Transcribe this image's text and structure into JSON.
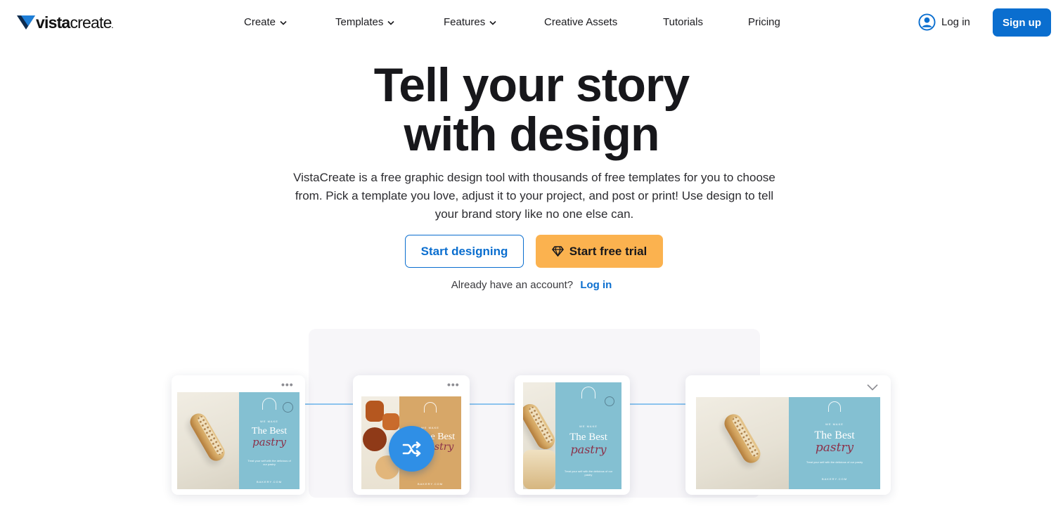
{
  "brand": {
    "logo_bold": "vista",
    "logo_light": "create",
    "logo_mark": "."
  },
  "nav": {
    "items": [
      {
        "label": "Create",
        "has_dropdown": true
      },
      {
        "label": "Templates",
        "has_dropdown": true
      },
      {
        "label": "Features",
        "has_dropdown": true
      },
      {
        "label": "Creative Assets",
        "has_dropdown": false
      },
      {
        "label": "Tutorials",
        "has_dropdown": false
      },
      {
        "label": "Pricing",
        "has_dropdown": false
      }
    ],
    "login_label": "Log in",
    "signup_label": "Sign up"
  },
  "hero": {
    "title_line1": "Tell your story",
    "title_line2": "with design",
    "subtitle": "VistaCreate is a free graphic design tool with thousands of free templates for you to choose from. Pick a template you love, adjust it to your project, and post or print! Use design to tell your brand story like no one else can.",
    "cta_primary": "Start designing",
    "cta_trial": "Start free trial",
    "account_prompt": "Already have an account?",
    "account_link": "Log in"
  },
  "illustration": {
    "card_heading": "The Best",
    "card_script": "pastry",
    "card_small": "WE MAKE",
    "card_body": "Treat your self with the delicious of our pastry",
    "card_brand": "BAKERY.COM"
  },
  "colors": {
    "accent": "#0a6ecf",
    "trial": "#fbb24f",
    "template_blue": "#84c0d2",
    "shuffle": "#2f8fe6"
  },
  "icons": [
    "logo-mark-icon",
    "chevron-down-icon",
    "user-circle-icon",
    "diamond-icon",
    "shuffle-icon",
    "more-dots-icon"
  ]
}
